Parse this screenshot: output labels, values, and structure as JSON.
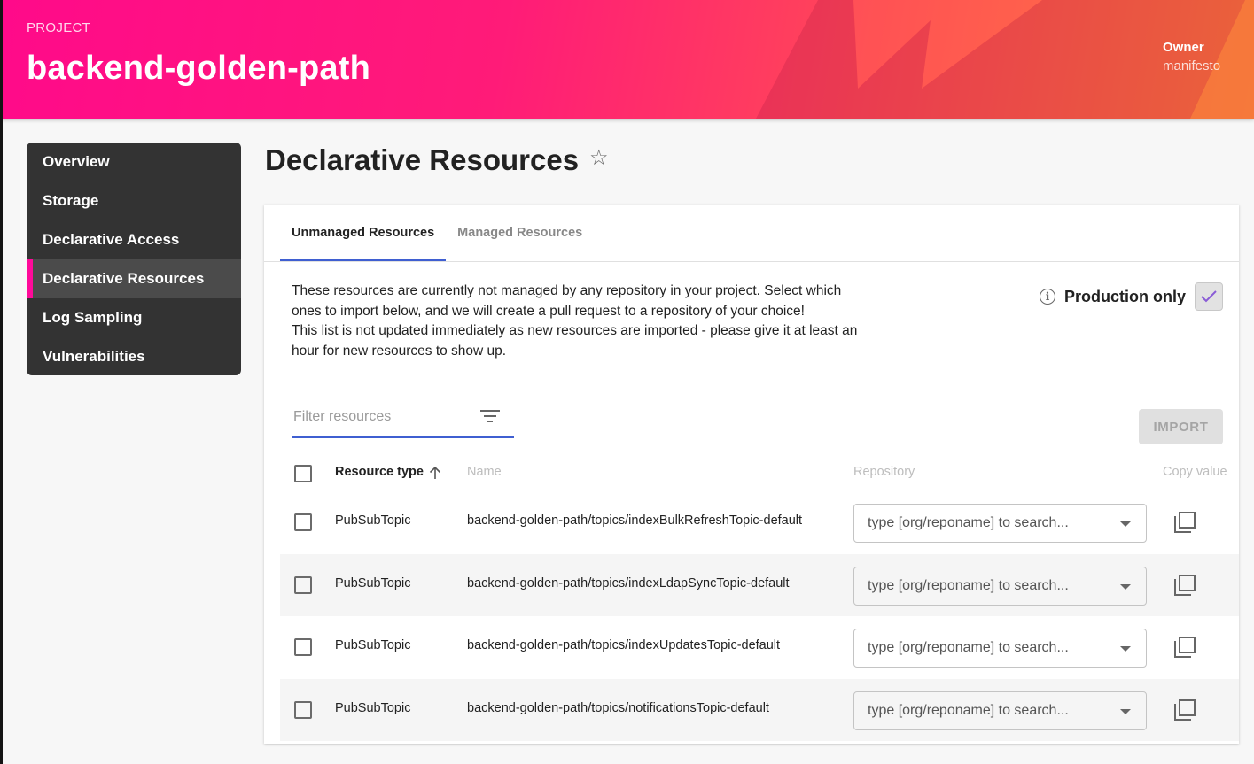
{
  "header": {
    "eyebrow": "PROJECT",
    "title": "backend-golden-path",
    "owner_label": "Owner",
    "owner_value": "manifesto"
  },
  "sidebar": {
    "items": [
      {
        "label": "Overview",
        "active": false
      },
      {
        "label": "Storage",
        "active": false
      },
      {
        "label": "Declarative Access",
        "active": false
      },
      {
        "label": "Declarative Resources",
        "active": true
      },
      {
        "label": "Log Sampling",
        "active": false
      },
      {
        "label": "Vulnerabilities",
        "active": false
      }
    ]
  },
  "page": {
    "title": "Declarative Resources",
    "favorite_icon": "star-outline-icon"
  },
  "tabs": [
    {
      "label": "Unmanaged Resources",
      "active": true
    },
    {
      "label": "Managed Resources",
      "active": false
    }
  ],
  "description": {
    "line1": "These resources are currently not managed by any repository in your project. Select which ones to import below, and we will create a pull request to a repository of your choice!",
    "line2": "This list is not updated immediately as new resources are imported - please give it at least an hour for new resources to show up."
  },
  "production_only": {
    "label": "Production only",
    "checked": true,
    "check_color": "#8a5cd6"
  },
  "filter": {
    "placeholder": "Filter resources",
    "value": ""
  },
  "import_button": {
    "label": "IMPORT",
    "disabled": true
  },
  "table": {
    "columns": {
      "resource_type": "Resource type",
      "name": "Name",
      "repository": "Repository",
      "copy_value": "Copy value"
    },
    "sort": {
      "column": "Resource type",
      "direction": "ascending"
    },
    "repo_placeholder": "type [org/reponame] to search...",
    "rows": [
      {
        "type": "PubSubTopic",
        "name": "backend-golden-path/topics/indexBulkRefreshTopic-default",
        "checked": false
      },
      {
        "type": "PubSubTopic",
        "name": "backend-golden-path/topics/indexLdapSyncTopic-default",
        "checked": false
      },
      {
        "type": "PubSubTopic",
        "name": "backend-golden-path/topics/indexUpdatesTopic-default",
        "checked": false
      },
      {
        "type": "PubSubTopic",
        "name": "backend-golden-path/topics/notificationsTopic-default",
        "checked": false
      }
    ]
  },
  "colors": {
    "accent_blue": "#3f5fd1",
    "active_nav_marker": "#ff0a9a",
    "sidebar_bg": "#333333"
  }
}
